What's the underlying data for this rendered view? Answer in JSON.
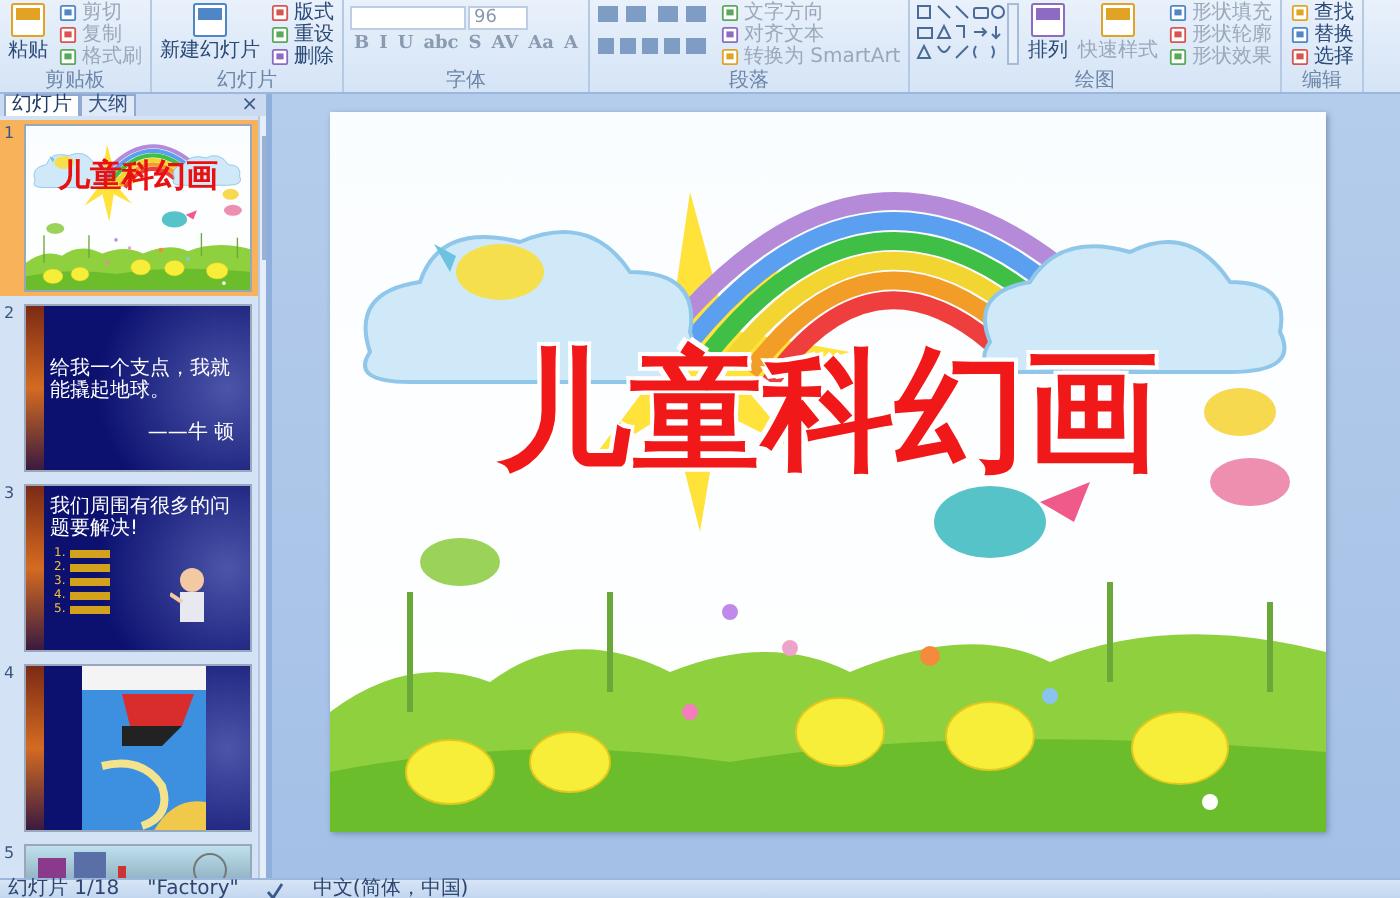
{
  "ribbon": {
    "groups": [
      {
        "label": "剪贴板",
        "kind": "clipboard",
        "items": [
          {
            "label": "粘贴",
            "kind": "large",
            "disabled": false
          },
          {
            "label": "剪切",
            "kind": "small",
            "disabled": true
          },
          {
            "label": "复制",
            "kind": "small",
            "disabled": true
          },
          {
            "label": "格式刷",
            "kind": "small",
            "disabled": true
          }
        ]
      },
      {
        "label": "幻灯片",
        "kind": "slides",
        "items": [
          {
            "label": "新建幻灯片",
            "kind": "large",
            "disabled": false
          },
          {
            "label": "版式",
            "kind": "small",
            "disabled": false
          },
          {
            "label": "重设",
            "kind": "small",
            "disabled": false
          },
          {
            "label": "删除",
            "kind": "small",
            "disabled": false
          }
        ]
      },
      {
        "label": "字体",
        "kind": "font",
        "items": [
          {
            "label": "96",
            "kind": "field",
            "disabled": true
          },
          {
            "label": "B",
            "kind": "glyph",
            "disabled": true
          },
          {
            "label": "I",
            "kind": "glyph",
            "disabled": true
          },
          {
            "label": "U",
            "kind": "glyph",
            "disabled": true
          },
          {
            "label": "abc",
            "kind": "glyph",
            "disabled": true
          },
          {
            "label": "S",
            "kind": "glyph",
            "disabled": true
          },
          {
            "label": "AV",
            "kind": "glyph",
            "disabled": true
          },
          {
            "label": "Aa",
            "kind": "glyph",
            "disabled": true
          },
          {
            "label": "A",
            "kind": "glyph",
            "disabled": true
          }
        ]
      },
      {
        "label": "段落",
        "kind": "paragraph",
        "items": [
          {
            "label": "文字方向",
            "kind": "small",
            "disabled": true
          },
          {
            "label": "对齐文本",
            "kind": "small",
            "disabled": true
          },
          {
            "label": "转换为 SmartArt",
            "kind": "small",
            "disabled": true
          }
        ]
      },
      {
        "label": "绘图",
        "kind": "drawing",
        "items": [
          {
            "label": "排列",
            "kind": "large",
            "disabled": false
          },
          {
            "label": "快速样式",
            "kind": "large",
            "disabled": true
          },
          {
            "label": "形状填充",
            "kind": "small",
            "disabled": true
          },
          {
            "label": "形状轮廓",
            "kind": "small",
            "disabled": true
          },
          {
            "label": "形状效果",
            "kind": "small",
            "disabled": true
          }
        ]
      },
      {
        "label": "编辑",
        "kind": "editing",
        "items": [
          {
            "label": "查找",
            "kind": "small",
            "disabled": false
          },
          {
            "label": "替换",
            "kind": "small",
            "disabled": false
          },
          {
            "label": "选择",
            "kind": "small",
            "disabled": false
          }
        ]
      }
    ]
  },
  "panel": {
    "tabs": [
      {
        "label": "幻灯片",
        "selected": true
      },
      {
        "label": "大纲",
        "selected": false
      }
    ],
    "close": "×"
  },
  "slides": [
    {
      "number": "1",
      "kind": "title",
      "selected": true,
      "title": "儿童科幻画"
    },
    {
      "number": "2",
      "kind": "quote",
      "selected": false,
      "text": "给我一个支点，我就能撬起地球。",
      "author": "——牛 顿"
    },
    {
      "number": "3",
      "kind": "list",
      "selected": false,
      "text": "我们周围有很多的问题要解决!",
      "bullets": [
        "1.",
        "2.",
        "3.",
        "4.",
        "5."
      ]
    },
    {
      "number": "4",
      "kind": "picture",
      "selected": false
    },
    {
      "number": "5",
      "kind": "partial",
      "selected": false
    }
  ],
  "slide": {
    "title": "儿童科幻画"
  },
  "status_bar": {
    "slide": "幻灯片 1/18",
    "theme": "\"Factory\"",
    "language": "中文(简体，中国)"
  }
}
